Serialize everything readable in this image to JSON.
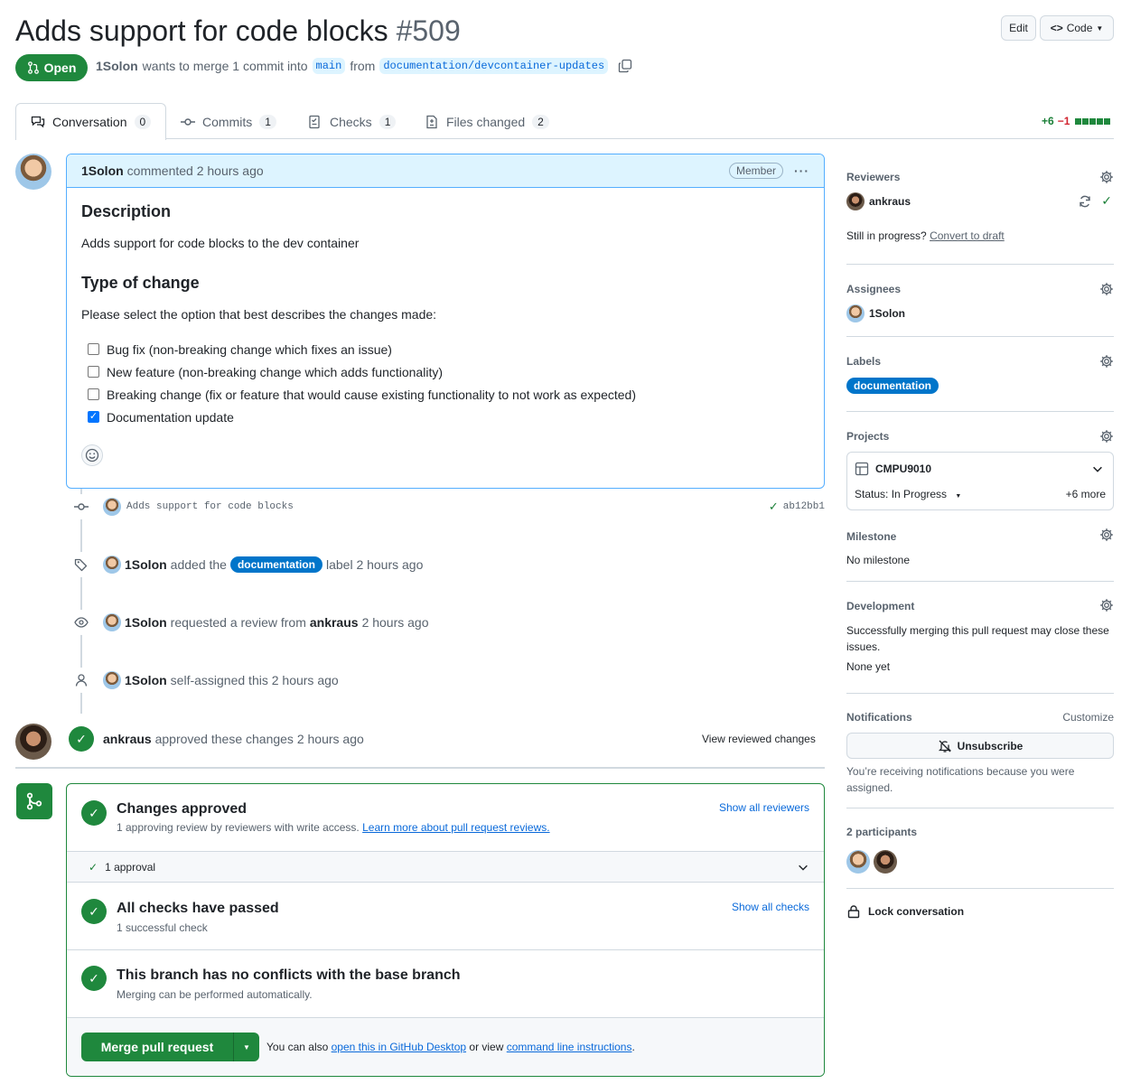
{
  "header": {
    "title": "Adds support for code blocks",
    "number": "#509",
    "edit_label": "Edit",
    "code_label": "Code",
    "state": "Open",
    "author": "1Solon",
    "merge_text": "wants to merge 1 commit into",
    "base_branch": "main",
    "from_text": "from",
    "head_branch": "documentation/devcontainer-updates"
  },
  "tabs": [
    {
      "label": "Conversation",
      "count": "0"
    },
    {
      "label": "Commits",
      "count": "1"
    },
    {
      "label": "Checks",
      "count": "1"
    },
    {
      "label": "Files changed",
      "count": "2"
    }
  ],
  "diffstat": {
    "added": "+6",
    "removed": "−1"
  },
  "comment": {
    "author": "1Solon",
    "meta": "commented 2 hours ago",
    "badge": "Member",
    "h_description": "Description",
    "description": "Adds support for code blocks to the dev container",
    "h_type": "Type of change",
    "prompt": "Please select the option that best describes the changes made:",
    "options": [
      {
        "label": "Bug fix (non-breaking change which fixes an issue)",
        "checked": false
      },
      {
        "label": "New feature (non-breaking change which adds functionality)",
        "checked": false
      },
      {
        "label": "Breaking change (fix or feature that would cause existing functionality to not work as expected)",
        "checked": false
      },
      {
        "label": "Documentation update",
        "checked": true
      }
    ]
  },
  "timeline": {
    "commit_msg": "Adds support for code blocks",
    "commit_sha": "ab12bb1",
    "label_event": {
      "actor": "1Solon",
      "pre": "added the",
      "label": "documentation",
      "post": "label 2 hours ago"
    },
    "review_event": {
      "actor": "1Solon",
      "pre": "requested a review from",
      "target": "ankraus",
      "post": "2 hours ago"
    },
    "assign_event": {
      "actor": "1Solon",
      "text": "self-assigned this 2 hours ago"
    },
    "approve_event": {
      "actor": "ankraus",
      "text": "approved these changes 2 hours ago",
      "link": "View reviewed changes"
    }
  },
  "merge_box": {
    "approved_title": "Changes approved",
    "approved_sub": "1 approving review by reviewers with write access.",
    "approved_link": "Learn more about pull request reviews.",
    "show_reviewers": "Show all reviewers",
    "approval_count": "1 approval",
    "checks_title": "All checks have passed",
    "checks_sub": "1 successful check",
    "show_checks": "Show all checks",
    "conflict_title": "This branch has no conflicts with the base branch",
    "conflict_sub": "Merging can be performed automatically.",
    "merge_button": "Merge pull request",
    "also_text": "You can also",
    "desktop_link": "open this in GitHub Desktop",
    "or_view": "or view",
    "cli_link": "command line instructions",
    "period": "."
  },
  "sidebar": {
    "reviewers_h": "Reviewers",
    "reviewer": "ankraus",
    "still_text": "Still in progress?",
    "draft_link": "Convert to draft",
    "assignees_h": "Assignees",
    "assignee": "1Solon",
    "labels_h": "Labels",
    "label": "documentation",
    "projects_h": "Projects",
    "project_name": "CMPU9010",
    "project_status": "Status: In Progress",
    "project_more": "+6 more",
    "milestone_h": "Milestone",
    "milestone": "No milestone",
    "development_h": "Development",
    "development_text": "Successfully merging this pull request may close these issues.",
    "development_none": "None yet",
    "notifications_h": "Notifications",
    "customize": "Customize",
    "unsubscribe": "Unsubscribe",
    "notif_reason": "You’re receiving notifications because you were assigned.",
    "participants_h": "2 participants",
    "lock": "Lock conversation"
  },
  "colors": {
    "green": "#1f883d",
    "blue": "#0969da",
    "label_blue": "#0075ca"
  }
}
